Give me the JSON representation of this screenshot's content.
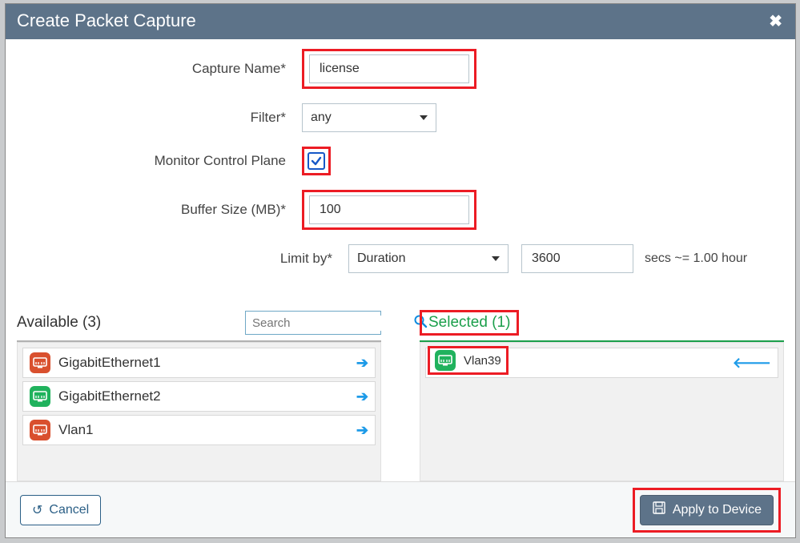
{
  "header": {
    "title": "Create Packet Capture"
  },
  "form": {
    "capture_name": {
      "label": "Capture Name*",
      "value": "license"
    },
    "filter": {
      "label": "Filter*",
      "value": "any"
    },
    "monitor": {
      "label": "Monitor Control Plane",
      "checked": true
    },
    "buffer": {
      "label": "Buffer Size (MB)*",
      "value": "100"
    },
    "limit": {
      "label": "Limit by*",
      "mode": "Duration",
      "value": "3600",
      "hint": "secs ~= 1.00 hour"
    }
  },
  "lists": {
    "available": {
      "title": "Available (3)",
      "search_placeholder": "Search",
      "items": [
        {
          "name": "GigabitEthernet1",
          "color": "orange"
        },
        {
          "name": "GigabitEthernet2",
          "color": "green"
        },
        {
          "name": "Vlan1",
          "color": "orange"
        }
      ]
    },
    "selected": {
      "title": "Selected (1)",
      "items": [
        {
          "name": "Vlan39",
          "color": "green"
        }
      ]
    }
  },
  "footer": {
    "cancel": "Cancel",
    "apply": "Apply to Device"
  }
}
